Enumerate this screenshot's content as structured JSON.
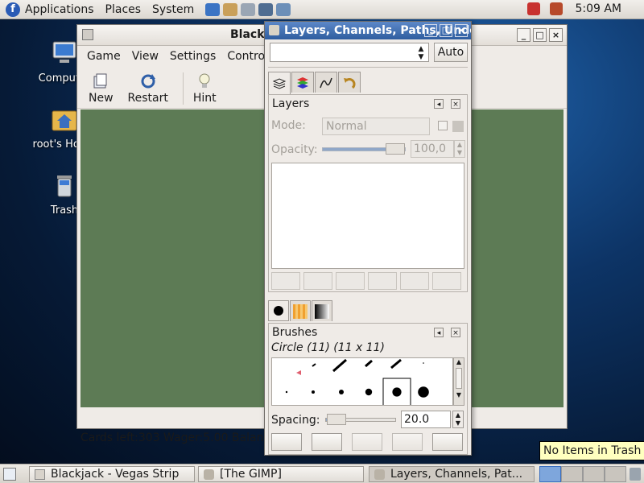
{
  "top_panel": {
    "menus": [
      "Applications",
      "Places",
      "System"
    ],
    "clock": "5:09 AM"
  },
  "desktop": {
    "icons": [
      {
        "label": "Computer"
      },
      {
        "label": "root's Home"
      },
      {
        "label": "Trash"
      }
    ]
  },
  "blackjack": {
    "title": "Blackjack - Vegas Strip",
    "menus": [
      "Game",
      "View",
      "Settings",
      "Control"
    ],
    "toolbar": {
      "new": "New",
      "restart": "Restart",
      "hint": "Hint"
    },
    "status": "Cards left:303  Wager:5.00  Balance:"
  },
  "dock": {
    "title": "Layers, Channels, Paths, Undo",
    "auto_label": "Auto",
    "layers": {
      "heading": "Layers",
      "mode_label": "Mode:",
      "mode_value": "Normal",
      "opacity_label": "Opacity:",
      "opacity_value": "100,0",
      "opacity_percent": 100
    },
    "brushes": {
      "heading": "Brushes",
      "current": "Circle (11) (11 x 11)",
      "spacing_label": "Spacing:",
      "spacing_value": "20.0",
      "spacing_percent": 20
    }
  },
  "taskbar": {
    "items": [
      {
        "label": "Blackjack - Vegas Strip"
      },
      {
        "label": "[The GIMP]"
      },
      {
        "label": "Layers, Channels, Pat..."
      }
    ]
  },
  "tooltip": "No Items in Trash"
}
